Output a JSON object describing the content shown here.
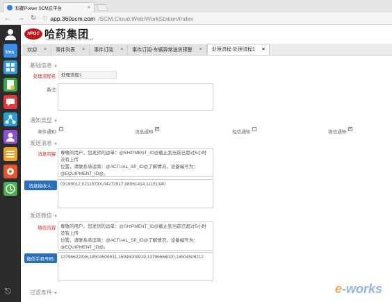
{
  "browser": {
    "tab_title": "科都Power SCM云平台",
    "tab_close": "×",
    "url_host": "app.360scm.com",
    "url_path": "/SCM.Cloud.Web/WorkStation/Index"
  },
  "header": {
    "logo_badge": "HPGC",
    "logo_cn": "哈药集团",
    "logo_en": "HARBIN PHARMACEUTICAL GROUP"
  },
  "tabs": [
    {
      "label": "欢迎"
    },
    {
      "label": "事件列表"
    },
    {
      "label": "事件订阅"
    },
    {
      "label": "事件订阅-车辆异常送货预警"
    },
    {
      "label": "处理流程-处理流程1"
    }
  ],
  "sections": {
    "basic": "基础信息",
    "notify": "通知类型",
    "send_msg": "发送消息",
    "send_wx": "发送微信",
    "filter": "过滤条件"
  },
  "basic": {
    "flow_name_label": "处理流程名:",
    "flow_name_value": "处理流程1",
    "remark_label": "备注:",
    "remark_value": ""
  },
  "notify": {
    "email_label": "邮件通知:",
    "email_checked": false,
    "message_label": "消息通知:",
    "message_checked": true,
    "sms_label": "短信通知:",
    "sms_checked": false,
    "wechat_label": "微信通知:",
    "wechat_checked": true
  },
  "send_msg": {
    "content_label": "消息内容:",
    "content_line1": "尊敬的用户，您发货的运单：@SHIPMENT_ID@截止到当前已超过5小时没有上传",
    "content_line2": "位置，请联系承运商：@ACTUAL_SP_ID@了解情况，设备编号为：",
    "content_line3": "@EQUIPMENT_ID@。",
    "receiver_button": "消息接收人:",
    "receiver_value": "03190012,0211573X,04272917,08061414,11151340"
  },
  "send_wx": {
    "content_label": "微信内容:",
    "content_line1": "尊敬的用户，您发货的运单：@SHIPMENT_ID@截止到当前已超过5小时没有上传",
    "content_line2": "位置，请联系承运商：@ACTUAL_SP_ID@了解情况，设备编号为：",
    "content_line3": "@EQUIPMENT_ID@。",
    "phone_button": "微信手机号码:",
    "phone_value": "13796622836,18504509031,15946009919,13796666020,18504509212"
  },
  "watermark": {
    "prefix": "e",
    "rest": "-works"
  },
  "colors": {
    "accent_blue": "#2a6ebb",
    "required_red": "#e02020",
    "sidebar_bg": "#2b2b2b",
    "logo_red": "#c1161c"
  }
}
